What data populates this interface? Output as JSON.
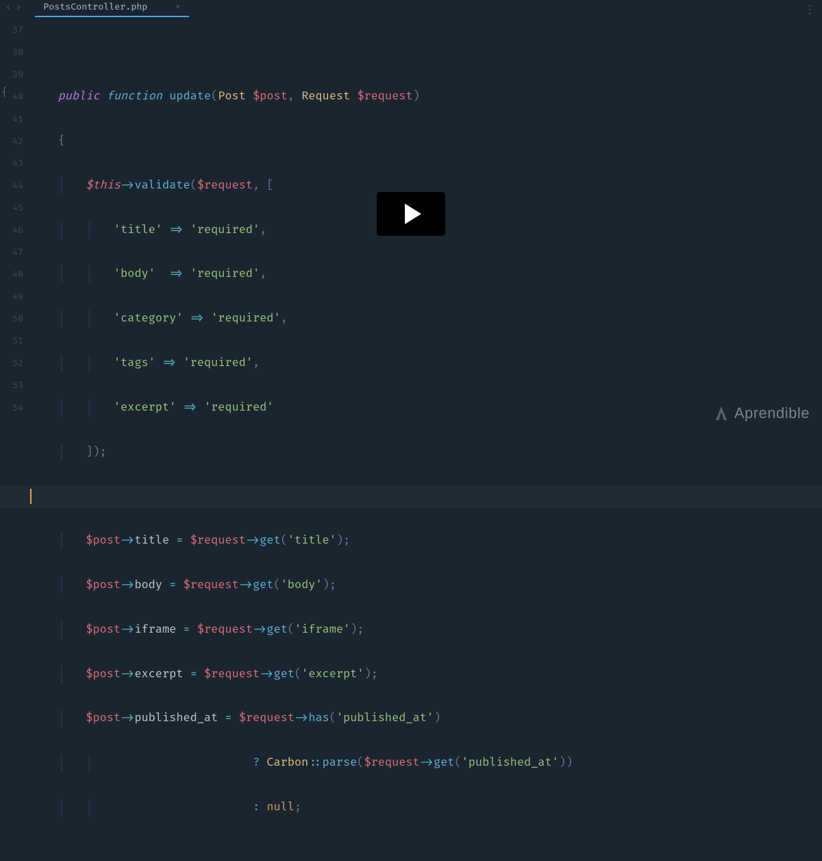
{
  "titlebar": {
    "tab_name": "PostsController.php",
    "close": "×",
    "more": "⋮"
  },
  "gutter": {
    "fold_brace": "{",
    "lines": [
      "37",
      "38",
      "39",
      "40",
      "41",
      "42",
      "43",
      "44",
      "45",
      "46",
      "47",
      "48",
      "49",
      "50",
      "51",
      "52",
      "53",
      "54"
    ]
  },
  "brand": {
    "text": "Aprendible"
  },
  "code": {
    "l1": "",
    "l2": {
      "kw_public": "public",
      "kw_function": "function",
      "name": "update",
      "p_open": "(",
      "t_post": "Post ",
      "v_post": "$post",
      "comma": ", ",
      "t_req": "Request ",
      "v_req": "$request",
      "p_close": ")"
    },
    "l3": {
      "brace": "{"
    },
    "l4": {
      "v_this": "$this",
      "arrow": "->",
      "fn": "validate",
      "open": "(",
      "v_req": "$request",
      "comma": ", [",
      "": ""
    },
    "l5": {
      "k": "'title'",
      "arrow": " => ",
      "v": "'required'",
      "comma": ","
    },
    "l6": {
      "k": "'body'",
      "arrow": "  => ",
      "v": "'required'",
      "comma": ","
    },
    "l7": {
      "k": "'category'",
      "arrow": " => ",
      "v": "'required'",
      "comma": ","
    },
    "l8": {
      "k": "'tags'",
      "arrow": " => ",
      "v": "'required'",
      "comma": ","
    },
    "l9": {
      "k": "'excerpt'",
      "arrow": " => ",
      "v": "'required'"
    },
    "l10": {
      "close": "]);"
    },
    "l12": {
      "v_post": "$post",
      "arrow1": "->",
      "prop": "title",
      "eq": " = ",
      "v_req": "$request",
      "arrow2": "->",
      "fn": "get",
      "open": "(",
      "arg": "'title'",
      "close": ");"
    },
    "l13": {
      "v_post": "$post",
      "arrow1": "->",
      "prop": "body",
      "eq": " = ",
      "v_req": "$request",
      "arrow2": "->",
      "fn": "get",
      "open": "(",
      "arg": "'body'",
      "close": ");"
    },
    "l14": {
      "v_post": "$post",
      "arrow1": "->",
      "prop": "iframe",
      "eq": " = ",
      "v_req": "$request",
      "arrow2": "->",
      "fn": "get",
      "open": "(",
      "arg": "'iframe'",
      "close": ");"
    },
    "l15": {
      "v_post": "$post",
      "arrow1": "->",
      "prop": "excerpt",
      "eq": " = ",
      "v_req": "$request",
      "arrow2": "->",
      "fn": "get",
      "open": "(",
      "arg": "'excerpt'",
      "close": ");"
    },
    "l16": {
      "v_post": "$post",
      "arrow1": "->",
      "prop": "published_at",
      "eq": " = ",
      "v_req": "$request",
      "arrow2": "->",
      "fn": "has",
      "open": "(",
      "arg": "'published_at'",
      "close": ")"
    },
    "l17": {
      "q": "? ",
      "cls": "Carbon",
      "scope": "::",
      "fn": "parse",
      "open": "(",
      "v_req": "$request",
      "arrow": "->",
      "fn2": "get",
      "open2": "(",
      "arg": "'published_at'",
      "close": "))"
    },
    "l18": {
      "colon": ": ",
      "null": "null",
      "semi": ";"
    }
  }
}
